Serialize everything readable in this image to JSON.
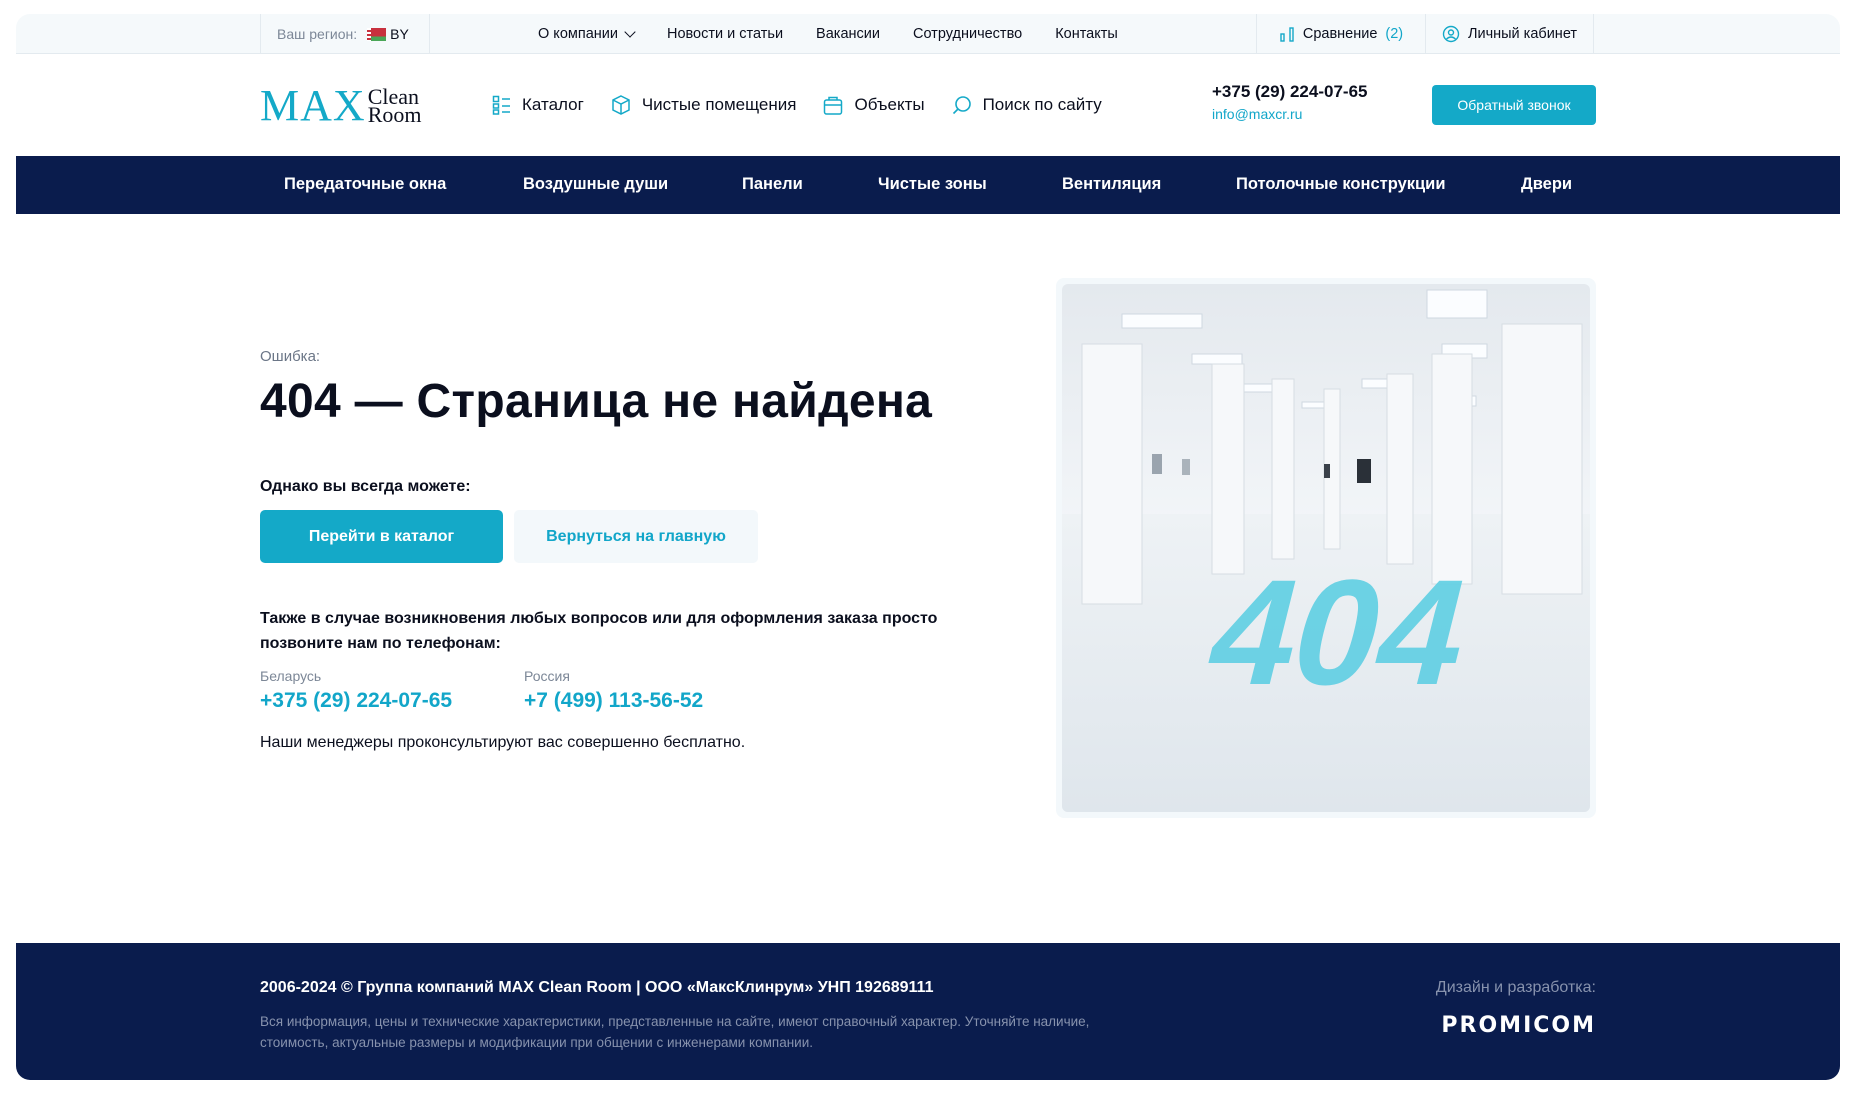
{
  "topbar": {
    "region_label": "Ваш регион:",
    "region_code": "BY",
    "nav": [
      {
        "label": "О компании"
      },
      {
        "label": "Новости и статьи"
      },
      {
        "label": "Вакансии"
      },
      {
        "label": "Сотрудничество"
      },
      {
        "label": "Контакты"
      }
    ],
    "compare_label": "Сравнение",
    "compare_count": "(2)",
    "cabinet_label": "Личный кабинет"
  },
  "header": {
    "logo_main": "MAX",
    "logo_line1": "Clean",
    "logo_line2": "Room",
    "nav": {
      "catalog": "Каталог",
      "clean_rooms": "Чистые помещения",
      "objects": "Объекты",
      "search": "Поиск по сайту"
    },
    "phone": "+375 (29) 224-07-65",
    "email": "info@maxcr.ru",
    "callback_label": "Обратный звонок"
  },
  "categories": [
    "Передаточные окна",
    "Воздушные души",
    "Панели",
    "Чистые зоны",
    "Вентиляция",
    "Потолочные конструкции",
    "Двери"
  ],
  "content": {
    "error_label": "Ошибка:",
    "title": "404 — Страница не найдена",
    "can_text": "Однако вы всегда можете:",
    "btn_catalog": "Перейти в каталог",
    "btn_home": "Вернуться на главную",
    "also_text": "Также в случае возникновения любых вопросов или для оформления заказа просто позвоните нам по телефонам:",
    "belarus_label": "Беларусь",
    "belarus_phone": "+375 (29) 224-07-65",
    "russia_label": "Россия",
    "russia_phone": "+7 (499) 113-56-52",
    "managers_text": "Наши менеджеры проконсультируют вас совершенно бесплатно.",
    "image_text": "404"
  },
  "footer": {
    "copyright": "2006-2024 © Группа компаний MAX Clean Room | ООО «МаксКлинрум» УНП 192689111",
    "disclaimer": "Вся информация, цены и технические характеристики, представленные на сайте, имеют справочный характер. Уточняйте наличие, стоимость, актуальные размеры и модификации при общении с инженерами компании.",
    "design_label": "Дизайн и разработка:",
    "developer": "PROMICOM"
  },
  "colors": {
    "accent": "#14a9c8",
    "navy": "#0a1c4d",
    "text": "#0b0f1e",
    "muted": "#7c8797"
  }
}
